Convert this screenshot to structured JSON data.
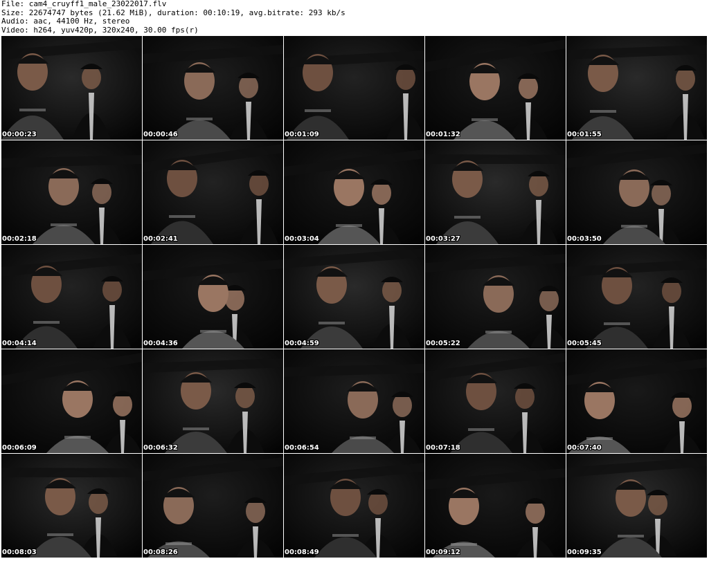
{
  "header": {
    "file_line": "File: cam4_cruyff1_male_23022017.flv",
    "size_line": "Size: 22674747 bytes (21.62 MiB), duration: 00:10:19, avg.bitrate: 293 kb/s",
    "audio_line": "Audio: aac, 44100 Hz, stereo",
    "video_line": "Video: h264, yuv420p, 320x240, 30.00 fps(r)"
  },
  "thumbnails": [
    {
      "timestamp": "00:00:23"
    },
    {
      "timestamp": "00:00:46"
    },
    {
      "timestamp": "00:01:09"
    },
    {
      "timestamp": "00:01:32"
    },
    {
      "timestamp": "00:01:55"
    },
    {
      "timestamp": "00:02:18"
    },
    {
      "timestamp": "00:02:41"
    },
    {
      "timestamp": "00:03:04"
    },
    {
      "timestamp": "00:03:27"
    },
    {
      "timestamp": "00:03:50"
    },
    {
      "timestamp": "00:04:14"
    },
    {
      "timestamp": "00:04:36"
    },
    {
      "timestamp": "00:04:59"
    },
    {
      "timestamp": "00:05:22"
    },
    {
      "timestamp": "00:05:45"
    },
    {
      "timestamp": "00:06:09"
    },
    {
      "timestamp": "00:06:32"
    },
    {
      "timestamp": "00:06:54"
    },
    {
      "timestamp": "00:07:18"
    },
    {
      "timestamp": "00:07:40"
    },
    {
      "timestamp": "00:08:03"
    },
    {
      "timestamp": "00:08:26"
    },
    {
      "timestamp": "00:08:49"
    },
    {
      "timestamp": "00:09:12"
    },
    {
      "timestamp": "00:09:35"
    }
  ],
  "colors": {
    "background": "#ffffff",
    "frame_background": "#050505",
    "timestamp_text": "#ffffff",
    "header_text": "#000000"
  }
}
